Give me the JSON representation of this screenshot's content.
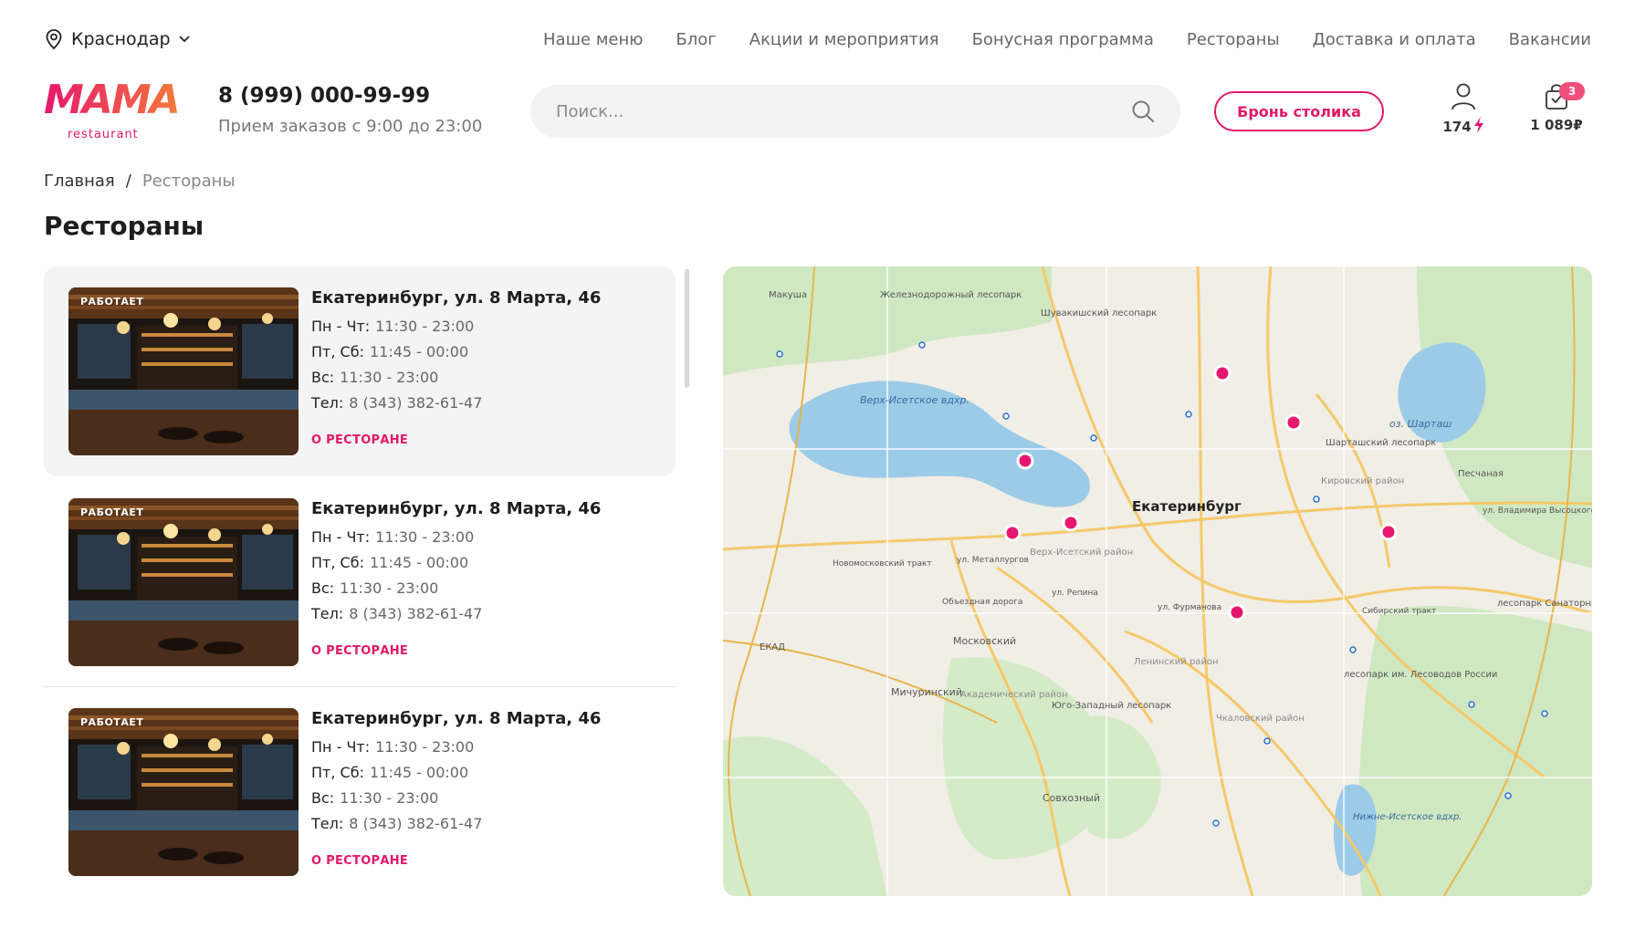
{
  "topbar": {
    "city": "Краснодар",
    "nav": [
      "Наше меню",
      "Блог",
      "Акции и мероприятия",
      "Бонусная программа",
      "Рестораны",
      "Доставка и оплата",
      "Вакансии"
    ]
  },
  "header": {
    "logo_word": "MAMA",
    "logo_sub": "restaurant",
    "phone": "8 (999) 000-99-99",
    "hours": "Прием заказов с 9:00 до 23:00",
    "search_placeholder": "Поиск...",
    "book_label": "Бронь столика",
    "points": "174",
    "cart_count": "3",
    "cart_sum": "1 089₽"
  },
  "breadcrumb": {
    "home": "Главная",
    "separator": "/",
    "current": "Рестораны"
  },
  "page_title": "Рестораны",
  "restaurants": [
    {
      "status": "РАБОТАЕТ",
      "address": "Екатеринбург, ул. 8 Марта, 46",
      "mon_thu_label": "Пн - Чт:",
      "mon_thu": "11:30 - 23:00",
      "fri_sat_label": "Пт, Сб:",
      "fri_sat": "11:45 - 00:00",
      "sun_label": "Вс:",
      "sun": "11:30 - 23:00",
      "phone_label": "Тел:",
      "phone": "8 (343) 382-61-47",
      "link": "О РЕСТОРАНЕ"
    },
    {
      "status": "РАБОТАЕТ",
      "address": "Екатеринбург, ул. 8 Марта, 46",
      "mon_thu_label": "Пн - Чт:",
      "mon_thu": "11:30 - 23:00",
      "fri_sat_label": "Пт, Сб:",
      "fri_sat": "11:45 - 00:00",
      "sun_label": "Вс:",
      "sun": "11:30 - 23:00",
      "phone_label": "Тел:",
      "phone": "8 (343) 382-61-47",
      "link": "О РЕСТОРАНЕ"
    },
    {
      "status": "РАБОТАЕТ",
      "address": "Екатеринбург, ул. 8 Марта, 46",
      "mon_thu_label": "Пн - Чт:",
      "mon_thu": "11:30 - 23:00",
      "fri_sat_label": "Пт, Сб:",
      "fri_sat": "11:45 - 00:00",
      "sun_label": "Вс:",
      "sun": "11:30 - 23:00",
      "phone_label": "Тел:",
      "phone": "8 (343) 382-61-47",
      "link": "О РЕСТОРАНЕ"
    }
  ],
  "map": {
    "city_label": "Екатеринбург",
    "lake_upper": "Верх-Исетское вдхр.",
    "lake_shartash": "оз. Шарташ",
    "lake_lower": "Нижне-Исетское вдхр.",
    "labels": [
      "Макуша",
      "Железнодорожный лесопарк",
      "Шувакишский лесопарк",
      "Шарташский лесопарк",
      "Песчаная",
      "Кировский район",
      "Верх-Исетский район",
      "Ленинский район",
      "Академический район",
      "Юго-Западный лесопарк",
      "Чкаловский район",
      "Московский",
      "Мичуринский",
      "Совхозный",
      "лесопарк Санаторный",
      "лесопарк им. Лесоводов России",
      "ЕКАД",
      "ул. Металлургов",
      "ул. Фурманова",
      "Сибирский тракт",
      "ул. Владимира Высоцкого",
      "Новомосковский тракт",
      "Объездная дорога",
      "ул. Репина"
    ],
    "pin_color": "#e6186d",
    "marker_count": 7
  },
  "colors": {
    "accent": "#e11868",
    "badge": "#f0507a"
  }
}
